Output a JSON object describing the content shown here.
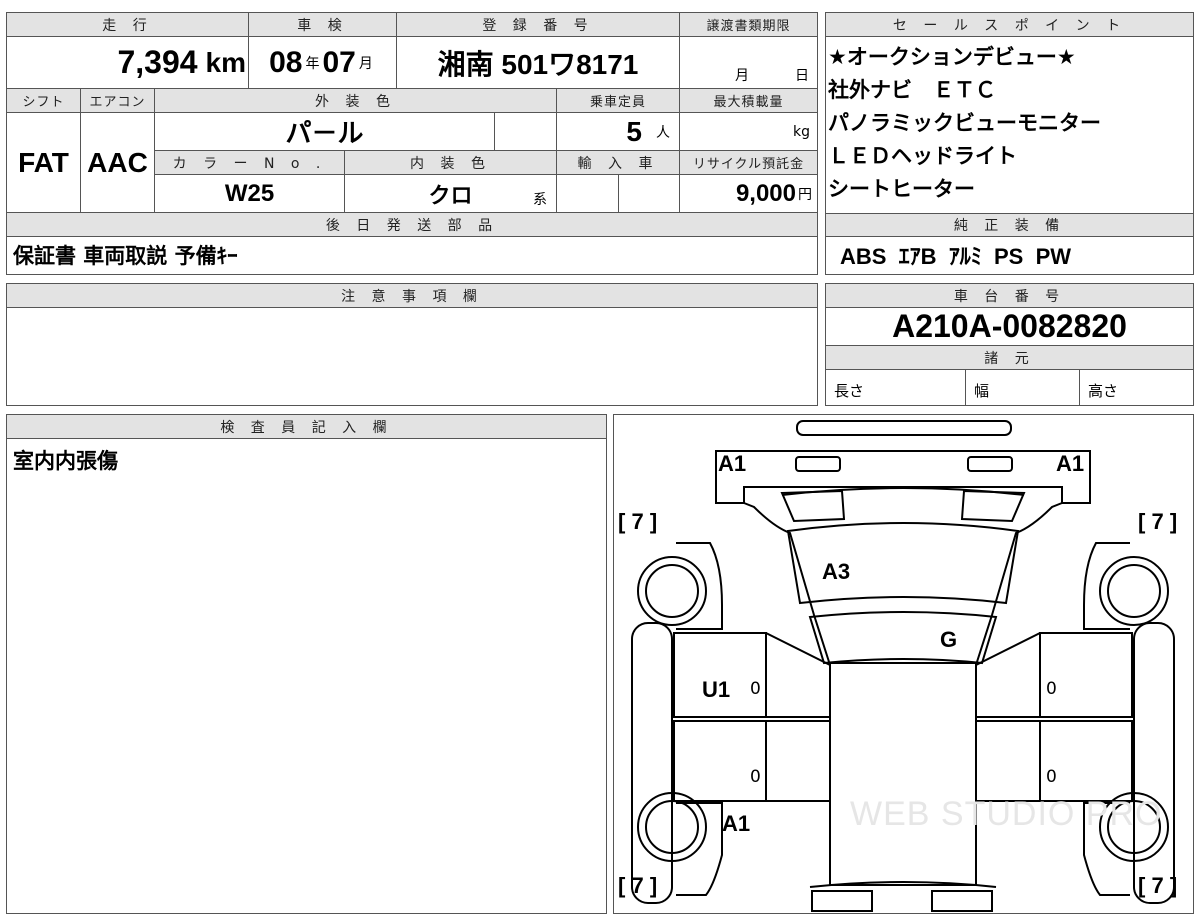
{
  "main_table": {
    "headers": {
      "mileage": "走 行",
      "inspection": "車 検",
      "registration": "登 録 番 号",
      "transfer_deadline": "譲渡書類期限",
      "shift": "シフト",
      "aircon": "エアコン",
      "exterior_color": "外 装 色",
      "capacity": "乗車定員",
      "max_load": "最大積載量",
      "color_no": "カ ラ ー N o .",
      "interior_color": "内 装 色",
      "import": "輸 入 車",
      "recycle": "リサイクル預託金",
      "later_parts": "後 日 発 送 部 品"
    },
    "mileage": "7,394",
    "mileage_unit": "km",
    "inspection_year": "08",
    "inspection_year_unit": "年",
    "inspection_month": "07",
    "inspection_month_unit": "月",
    "registration_number": "湘南 501ワ8171",
    "deadline_month_unit": "月",
    "deadline_day_unit": "日",
    "shift": "FAT",
    "aircon": "AAC",
    "exterior_color": "パ－ル",
    "capacity": "5",
    "capacity_unit": "人",
    "max_load_unit": "kg",
    "color_no": "W25",
    "interior_color": "クロ",
    "interior_color_unit": "系",
    "recycle_fee": "9,000",
    "recycle_unit": "円",
    "later_parts": "保証書 車両取説 予備ｷｰ"
  },
  "sales_points": {
    "header": "セ ー ル ス ポ イ ン ト",
    "items": [
      "★オークションデビュー★",
      "社外ナビ　ＥＴＣ",
      "パノラミックビューモニター",
      "ＬＥＤヘッドライト",
      "シートヒーター"
    ]
  },
  "standard_equipment": {
    "header": "純 正 装 備",
    "value": "ABS  ｴｱB  ｱﾙﾐ  PS  PW"
  },
  "notes": {
    "header": "注 意 事 項 欄",
    "content": ""
  },
  "chassis": {
    "header": "車 台 番 号",
    "number": "A210A-0082820",
    "spec_header": "諸 元",
    "length_label": "長さ",
    "width_label": "幅",
    "height_label": "高さ"
  },
  "inspector": {
    "header": "検 査 員 記 入 欄",
    "content": "室内内張傷"
  },
  "diagram": {
    "marks": {
      "front_left": "A1",
      "front_right": "A1",
      "hood": "A3",
      "windshield": "G",
      "left_front_door": "U1",
      "left_rear": "A1"
    },
    "tire_front_left": "7",
    "tire_front_right": "7",
    "tire_rear_left": "7",
    "tire_rear_right": "7",
    "door_zero_1": "0",
    "door_zero_2": "0",
    "door_zero_3": "0",
    "door_zero_4": "0",
    "watermark": "WEB STUDIO PRO"
  }
}
